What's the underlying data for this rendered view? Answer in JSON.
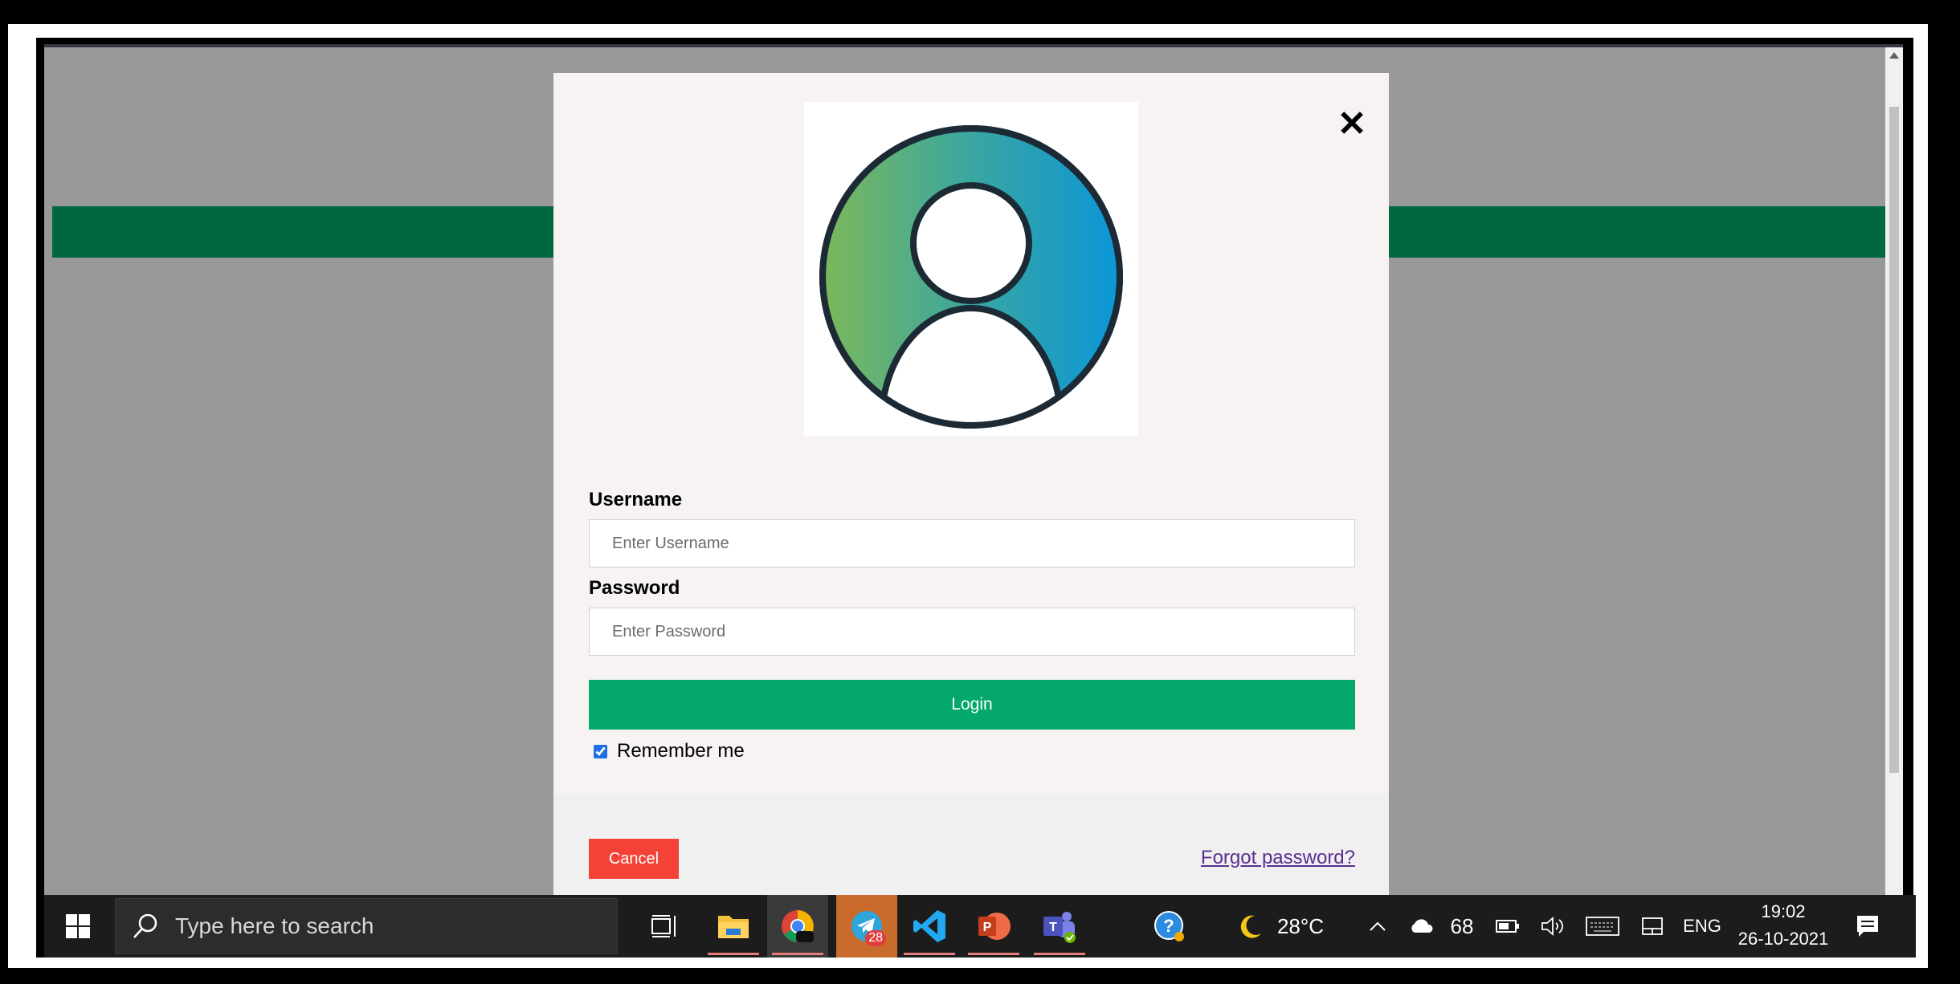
{
  "modal": {
    "username_label": "Username",
    "username_placeholder": "Enter Username",
    "password_label": "Password",
    "password_placeholder": "Enter Password",
    "login_label": "Login",
    "remember_label": "Remember me",
    "remember_checked": true,
    "cancel_label": "Cancel",
    "forgot_label": "Forgot password?",
    "close_glyph": "✕"
  },
  "colors": {
    "green_band": "#006840",
    "login_button": "#04a86a",
    "cancel_button": "#f44336",
    "link": "#5c2d91"
  },
  "taskbar": {
    "search_placeholder": "Type here to search",
    "apps": [
      {
        "name": "task-view-icon"
      },
      {
        "name": "file-explorer-icon"
      },
      {
        "name": "chrome-icon"
      },
      {
        "name": "telegram-icon",
        "badge": "28"
      },
      {
        "name": "vscode-icon"
      },
      {
        "name": "powerpoint-icon"
      },
      {
        "name": "teams-icon"
      }
    ],
    "weather_temp": "28°C",
    "onedrive_count": "68",
    "language": "ENG",
    "time": "19:02",
    "date": "26-10-2021"
  }
}
